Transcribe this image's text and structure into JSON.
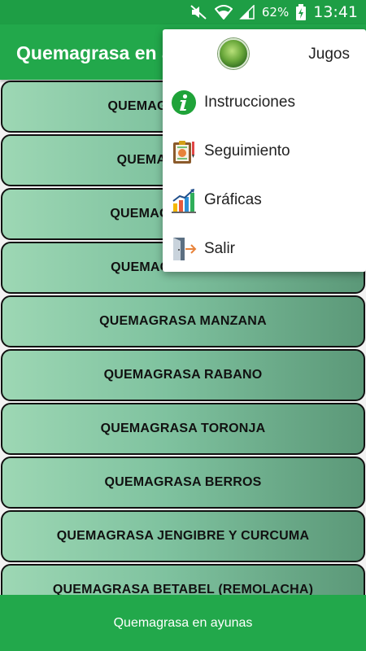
{
  "status_bar": {
    "battery_percent": "62%",
    "time": "13:41",
    "icons": [
      "mute-icon",
      "wifi-icon",
      "signal-icon",
      "battery-charging-icon"
    ]
  },
  "app_bar": {
    "title": "Quemagrasa en ayunas"
  },
  "list": {
    "items": [
      "QUEMAGRASA PEPINO",
      "QUEMAGRASA APIO",
      "QUEMAGRASA NOPAL",
      "QUEMAGRASA ELOTE",
      "QUEMAGRASA MANZANA",
      "QUEMAGRASA RABANO",
      "QUEMAGRASA TORONJA",
      "QUEMAGRASA BERROS",
      "QUEMAGRASA JENGIBRE Y CURCUMA",
      "QUEMAGRASA BETABEL (REMOLACHA)"
    ]
  },
  "bottom_bar": {
    "label": "Quemagrasa en ayunas"
  },
  "menu": {
    "header_label": "Jugos",
    "items": [
      {
        "label": "Instrucciones",
        "icon": "info-icon"
      },
      {
        "label": "Seguimiento",
        "icon": "clipboard-icon"
      },
      {
        "label": "Gráficas",
        "icon": "chart-icon"
      },
      {
        "label": "Salir",
        "icon": "exit-door-icon"
      }
    ]
  },
  "colors": {
    "primary": "#22a84b",
    "status_bar": "#1e9e45",
    "button_gradient_start": "#9dd7b4",
    "button_gradient_end": "#5b9878"
  }
}
